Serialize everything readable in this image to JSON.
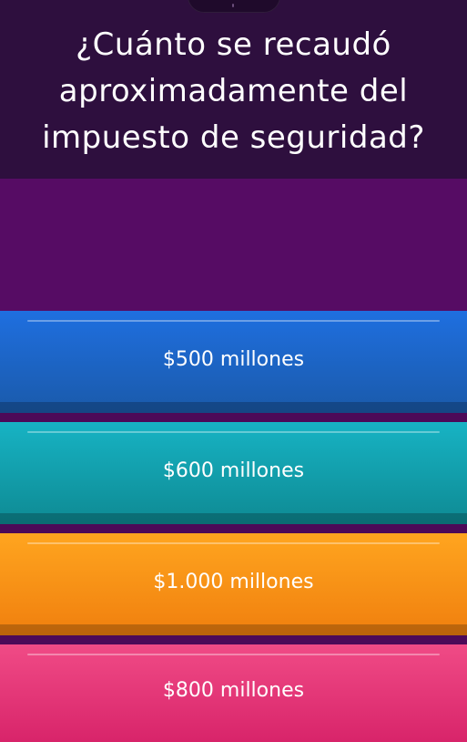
{
  "question": {
    "text": "¿Cuánto se recaudó aproximadamente del impuesto de seguridad?"
  },
  "answers": [
    {
      "label": "$500 millones",
      "color": "#1f6fe0"
    },
    {
      "label": "$600 millones",
      "color": "#17b3c4"
    },
    {
      "label": "$1.000 millones",
      "color": "#ffa51f"
    },
    {
      "label": "$800 millones",
      "color": "#f04b86"
    }
  ],
  "colors": {
    "question_background": "#2e0f3e",
    "media_background": "#560c64"
  }
}
